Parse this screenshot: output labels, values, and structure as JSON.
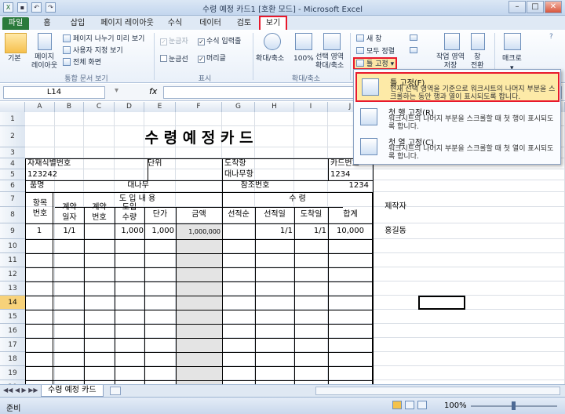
{
  "window": {
    "title": "수령 예정 카드1  [호환 모드] - Microsoft Excel",
    "min": "–",
    "max": "□",
    "close": "✕"
  },
  "tabs": [
    "파일",
    "홈",
    "삽입",
    "페이지 레이아웃",
    "수식",
    "데이터",
    "검토",
    "보기"
  ],
  "ribbon": {
    "workbook_views": {
      "normal": "기본",
      "page_layout": "페이지\n레이아웃",
      "page_break": "페이지 나누기 미리 보기",
      "custom": "사용자 지정 보기",
      "full": "전체 화면",
      "label": "통합 문서 보기"
    },
    "show": {
      "ruler": "눈금자",
      "formula_bar": "수식 입력줄",
      "gridlines": "눈금선",
      "headings": "머리글",
      "label": "표시"
    },
    "zoom": {
      "zoom": "확대/축소",
      "z100": "100%",
      "selection": "선택 영역\n확대/축소",
      "label": "확대/축소"
    },
    "window": {
      "new": "새 창",
      "arrange": "모두 정렬",
      "freeze": "틀 고정",
      "switch": "작업 영역\n저장",
      "switch2": "창\n전환"
    },
    "macros": {
      "label": "매크로"
    }
  },
  "formula": {
    "namebox": "L14",
    "fx": "fx",
    "value": ""
  },
  "columns": [
    "A",
    "B",
    "C",
    "D",
    "E",
    "F",
    "G",
    "H",
    "I",
    "J"
  ],
  "rows": [
    "1",
    "2",
    "3",
    "4",
    "5",
    "6",
    "7",
    "8",
    "9",
    "10",
    "11",
    "12",
    "13",
    "14",
    "15",
    "16",
    "17",
    "18",
    "19",
    "20"
  ],
  "sheet": {
    "title": "수 령 예 정 카 드",
    "material_no_label": "자재식별번호",
    "material_no": "123242",
    "unit_label": "단위",
    "arrival_label": "도착항",
    "arrival": "대나무항",
    "card_no_label": "카드번호",
    "card_no": "1234",
    "item_label": "품명",
    "item": "대나무",
    "ref_label": "참조번호",
    "ref": "1234",
    "line_no": "항목\n번호",
    "intro_hdr": "도 입 내 용",
    "recv_hdr": "수         령",
    "maker": "제작자",
    "c_date": "계약\n일자",
    "c_no": "계약\n번호",
    "qty": "도입\n수량",
    "price": "단가",
    "amount": "금액",
    "loader": "선적순",
    "ship_date": "선적일",
    "arr_date": "도착일",
    "total": "합계",
    "row9": {
      "n": "1",
      "date": "1/1",
      "qty": "1,000",
      "price": "1,000",
      "amount": "1,000,000",
      "sd": "1/1",
      "ad": "1/1",
      "total": "10,000",
      "maker": "홍길동"
    }
  },
  "menu": [
    {
      "title": "틀 고정(F)",
      "desc": "현재 선택 영역을 기준으로 워크시트의 나머지 부분을 스크롤하는 동안 행과 열이 표시되도록 합니다."
    },
    {
      "title": "첫 행 고정(R)",
      "desc": "워크시트의 나머지 부분을 스크롤할 때 첫 행이 표시되도록 합니다."
    },
    {
      "title": "첫 열 고정(C)",
      "desc": "워크시트의 나머지 부분을 스크롤할 때 첫 열이 표시되도록 합니다."
    }
  ],
  "sheet_tab": "수령 예정 카드",
  "status": {
    "ready": "준비",
    "zoom": "100%"
  }
}
